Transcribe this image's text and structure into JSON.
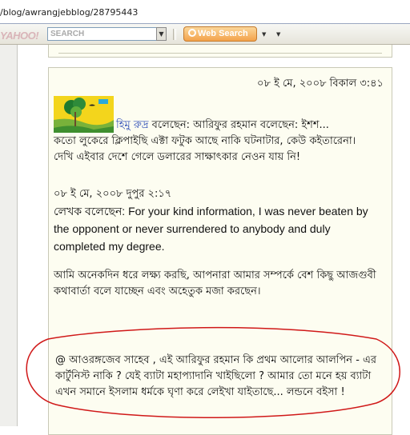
{
  "address_bar": {
    "url": "/blog/awrangjebblog/28795443"
  },
  "toolbar": {
    "logo_text": "YAHOO!",
    "search_placeholder": "SEARCH",
    "web_search_label": "Web Search"
  },
  "comment": {
    "date": "০৮ ই মে, ২০০৮ বিকাল ৩:৪১",
    "author": "হিমু রুদ্র",
    "text_part1": " বলেছেন: আরিফুর রহমান বলেছেন: ইশশ...",
    "text_part2": "কতো লুকেরে ক্লিপাইছি এক্টা ফটুক আছে নাকি ঘটনাটার, কেউ কইতারেনা। দেখি এইবার দেশে গেলে ডলারের সাক্ষাৎকার নেওন যায় নি!",
    "reply_date": "০৮ ই মে, ২০০৮ দুপুর ২:১৭",
    "reply_text": "লেখক বলেছেন: For your kind information, I was never beaten by the opponent or never surrendered to anybody and duly completed my degree.",
    "para2": "আমি অনেকদিন ধরে লক্ষ্য করছি, আপনারা আমার সম্পর্কে বেশ কিছু আজগুবী কথাবার্তা বলে যাচ্ছেন এবং অহেতুক মজা করছেন।",
    "para3": "@ আওরঙ্গজেব সাহেব , এই আরিফুর রহমান কি প্রথম আলোর আলপিন - এর কার্টুনিস্ট নাকি ? যেই ব্যাটা মহাপ্যাদানি খাইছিলো ? আমার তো মনে হয় ব্যাটা এখন সমানে ইসলাম ধর্মকে ঘৃণা করে লেইখা যাইতাছে... লন্ডনে বইসা !"
  },
  "colors": {
    "link": "#2a4ab6",
    "oval": "#d01818",
    "box_bg": "#fdfdf1"
  }
}
